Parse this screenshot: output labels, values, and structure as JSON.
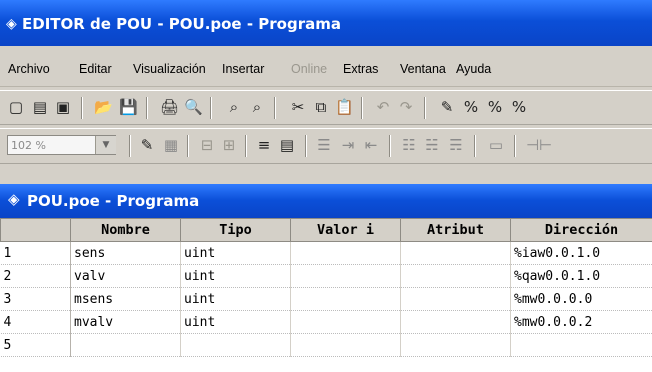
{
  "window": {
    "title": "EDITOR de POU - POU.poe - Programa",
    "icon": "app-icon"
  },
  "menu": [
    "Archivo",
    "Editar",
    "Visualización",
    "Insertar",
    "Online",
    "Extras",
    "Ventana",
    "Ayuda"
  ],
  "menu_disabled": [
    "Online"
  ],
  "toolbar": {
    "row1_icons": [
      "new-program-icon",
      "new-function-block-icon",
      "new-function-icon",
      "open-icon",
      "save-icon",
      "print-icon",
      "print-preview-icon",
      "find-icon",
      "find-next-icon",
      "cut-icon",
      "copy-icon",
      "paste-icon",
      "undo-icon",
      "redo-icon",
      "compile-icon",
      "toolbar-icon-percent-1",
      "toolbar-icon-percent-2",
      "toolbar-icon-percent-3"
    ],
    "zoom": "102 %"
  },
  "document": {
    "title": "POU.poe - Programa",
    "icon": "pou-icon"
  },
  "table": {
    "columns": [
      "Nombre",
      "Tipo",
      "Valor i",
      "Atribut",
      "Dirección"
    ],
    "rows": [
      {
        "num": "1",
        "nombre": "sens",
        "tipo": "uint",
        "valor": "",
        "atribut": "",
        "direccion": "%iaw0.0.1.0"
      },
      {
        "num": "2",
        "nombre": "valv",
        "tipo": "uint",
        "valor": "",
        "atribut": "",
        "direccion": "%qaw0.0.1.0"
      },
      {
        "num": "3",
        "nombre": "msens",
        "tipo": "uint",
        "valor": "",
        "atribut": "",
        "direccion": "%mw0.0.0.0"
      },
      {
        "num": "4",
        "nombre": "mvalv",
        "tipo": "uint",
        "valor": "",
        "atribut": "",
        "direccion": "%mw0.0.0.2"
      },
      {
        "num": "5",
        "nombre": "",
        "tipo": "",
        "valor": "",
        "atribut": "",
        "direccion": ""
      }
    ]
  }
}
